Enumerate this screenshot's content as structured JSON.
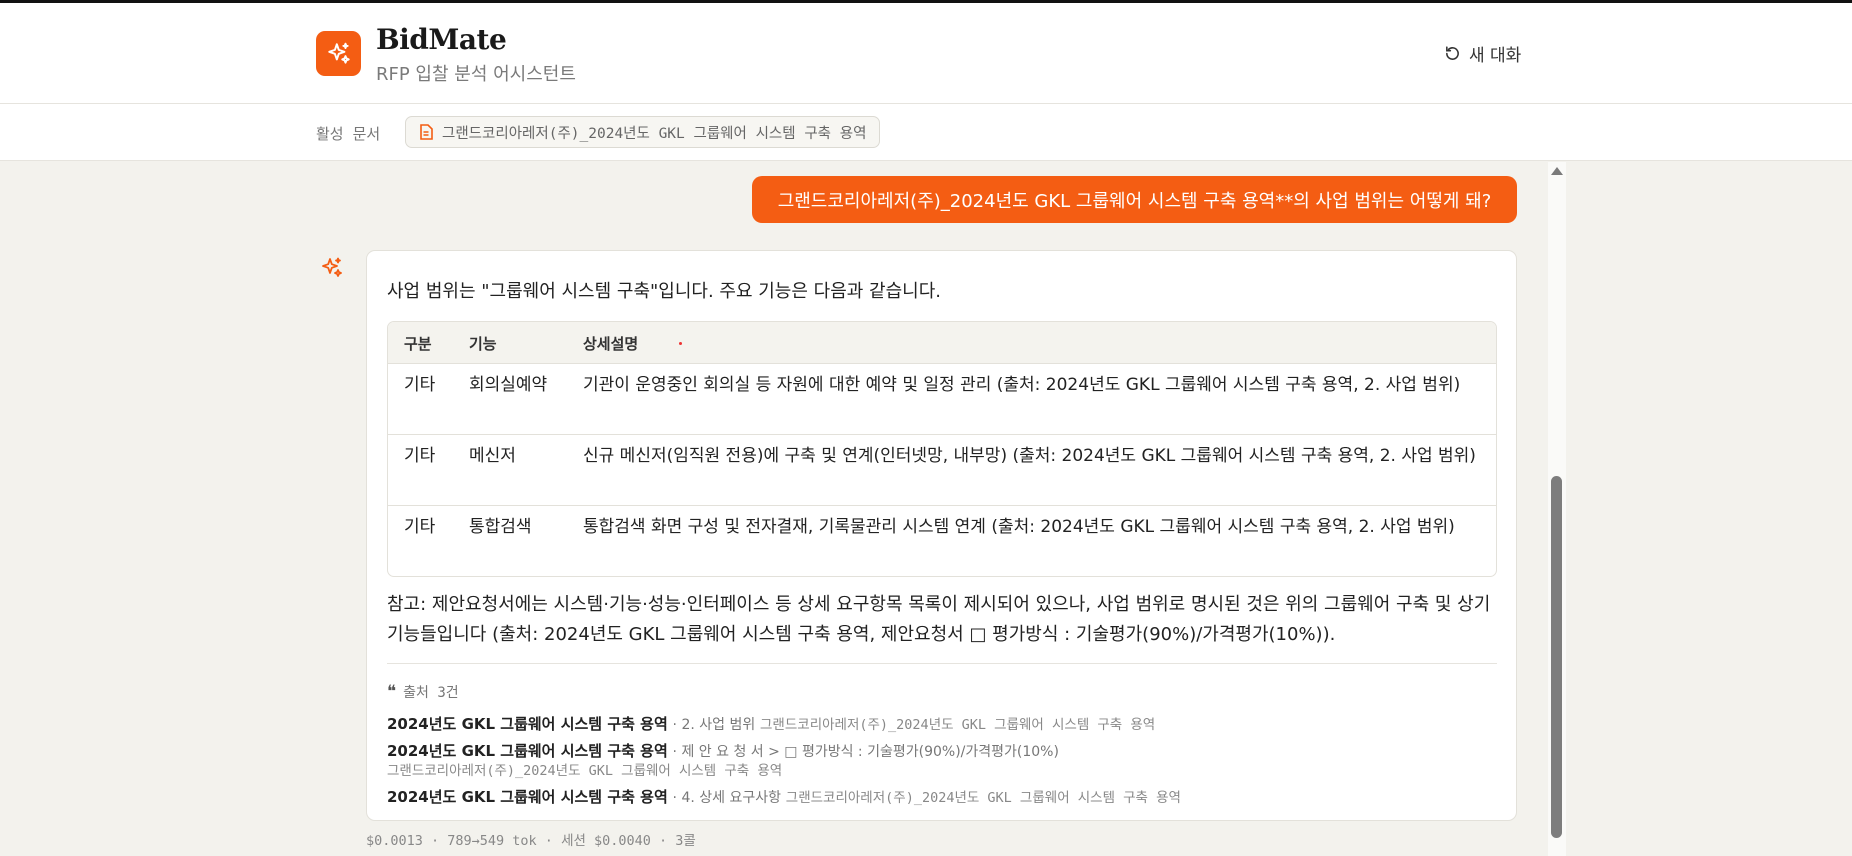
{
  "app": {
    "title": "BidMate",
    "subtitle": "RFP 입찰 분석 어시스턴트",
    "new_chat_label": "새 대화",
    "accent_color": "#f45d13"
  },
  "docbar": {
    "label": "활성 문서",
    "active_document": "그랜드코리아레저(주)_2024년도 GKL 그룹웨어 시스템 구축 용역"
  },
  "conversation": {
    "user_message": "그랜드코리아레저(주)_2024년도 GKL  그룹웨어 시스템 구축 용역**의 사업 범위는 어떻게 돼?",
    "assistant": {
      "intro": "사업 범위는 \"그룹웨어 시스템 구축\"입니다. 주요 기능은 다음과 같습니다.",
      "table": {
        "headers": [
          "구분",
          "기능",
          "상세설명"
        ],
        "rows": [
          [
            "기타",
            "회의실예약",
            "기관이 운영중인 회의실 등 자원에 대한 예약 및 일정 관리 (출처: 2024년도 GKL 그룹웨어 시스템 구축 용역, 2. 사업 범위)"
          ],
          [
            "기타",
            "메신저",
            "신규 메신저(임직원 전용)에 구축 및 연계(인터넷망, 내부망) (출처: 2024년도 GKL 그룹웨어 시스템 구축 용역, 2. 사업 범위)"
          ],
          [
            "기타",
            "통합검색",
            "통합검색 화면 구성 및 전자결재, 기록물관리 시스템 연계 (출처: 2024년도 GKL 그룹웨어 시스템 구축 용역, 2. 사업 범위)"
          ]
        ]
      },
      "note": "참고: 제안요청서에는 시스템·기능·성능·인터페이스 등 상세 요구항목 목록이 제시되어 있으나, 사업 범위로 명시된 것은 위의 그룹웨어 구축 및 상기 기능들입니다 (출처: 2024년도 GKL 그룹웨어 시스템 구축 용역, 제안요청서 □ 평가방식 : 기술평가(90%)/가격평가(10%)).",
      "sources_header": "출처 3건",
      "sources": [
        {
          "title": "2024년도 GKL 그룹웨어 시스템 구축 용역",
          "section": "· 2. 사업 범위",
          "doc": "그랜드코리아레저(주)_2024년도 GKL 그룹웨어 시스템 구축 용역"
        },
        {
          "title": "2024년도 GKL 그룹웨어 시스템 구축 용역",
          "section": "· 제 안 요 청 서 > □ 평가방식 : 기술평가(90%)/가격평가(10%)",
          "doc": "그랜드코리아레저(주)_2024년도 GKL 그룹웨어 시스템 구축 용역"
        },
        {
          "title": "2024년도 GKL 그룹웨어 시스템 구축 용역",
          "section": "· 4. 상세 요구사항",
          "doc": "그랜드코리아레저(주)_2024년도 GKL 그룹웨어 시스템 구축 용역"
        }
      ]
    },
    "meta": "$0.0013 · 789→549 tok · 세션 $0.0040 · 3콜"
  }
}
